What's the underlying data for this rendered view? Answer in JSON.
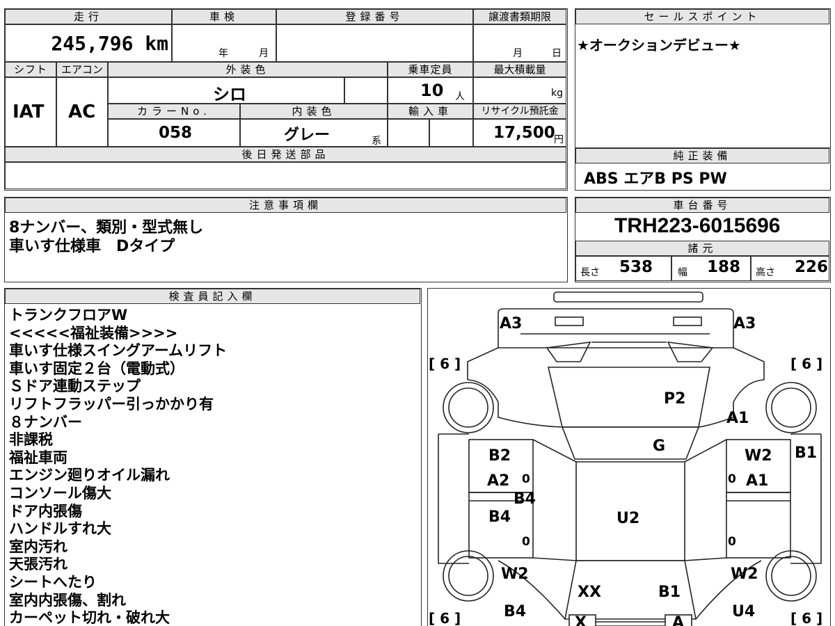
{
  "top": {
    "mileage_label": "走行",
    "mileage": "245,796 km",
    "inspection_label": "車検",
    "inspection_year": "年",
    "inspection_month": "月",
    "registration_label": "登録番号",
    "deadline_label": "譲渡書類期限",
    "deadline_month": "月",
    "deadline_day": "日"
  },
  "row2": {
    "shift_label": "シフト",
    "aircon_label": "エアコン",
    "exterior_label": "外装色",
    "capacity_label": "乗車定員",
    "load_label": "最大積載量",
    "shift": "IAT",
    "aircon": "AC",
    "exterior_color": "シロ",
    "capacity": "10",
    "capacity_unit": "人",
    "load_unit": "kg",
    "color_no_label": "カラーNo.",
    "interior_label": "内装色",
    "import_label": "輸入車",
    "recycle_label": "リサイクル預託金",
    "color_no": "058",
    "interior_color": "グレー",
    "interior_suffix": "系",
    "recycle_fee": "17,500",
    "recycle_unit": "円"
  },
  "later_parts_label": "後日発送部品",
  "sales": {
    "label": "セールスポイント",
    "text": "★オークションデビュー★"
  },
  "equipment": {
    "label": "純正装備",
    "text": "ABS エアB PS PW"
  },
  "caution": {
    "label": "注意事項欄",
    "lines": [
      "8ナンバー、類別・型式無し",
      "車いす仕様車　Dタイプ"
    ]
  },
  "chassis": {
    "label": "車台番号",
    "number": "TRH223-6015696",
    "specs_label": "諸元",
    "length_label": "長さ",
    "length": "538",
    "width_label": "幅",
    "width": "188",
    "height_label": "高さ",
    "height": "226"
  },
  "inspector": {
    "label": "検査員記入欄",
    "lines": [
      "トランクフロアW",
      "<<<<<福祉装備>>>>",
      "車いす仕様スイングアームリフト",
      "車いす固定２台（電動式）",
      "Ｓドア連動ステップ",
      "リフトフラッパー引っかかり有",
      "８ナンバー",
      "非課税",
      "福祉車両",
      "エンジン廻りオイル漏れ",
      "コンソール傷大",
      "ドア内張傷",
      "ハンドルすれ大",
      "室内汚れ",
      "天張汚れ",
      "シートへたり",
      "室内内張傷、割れ",
      "カーペット切れ・破れ大"
    ]
  },
  "diagram": {
    "marks": [
      "A3",
      "A3",
      "P2",
      "A1",
      "G",
      "B1",
      "B2",
      "W2",
      "A2",
      "A1",
      "B4",
      "B4",
      "U2",
      "W2",
      "W2",
      "XX",
      "B1",
      "B4",
      "U4",
      "X",
      "A"
    ],
    "tire_labels": [
      "[ 6 ]",
      "[ 6 ]",
      "[ 6 ]",
      "[ 6 ]"
    ],
    "zeros": [
      "0",
      "0",
      "0",
      "0"
    ]
  }
}
